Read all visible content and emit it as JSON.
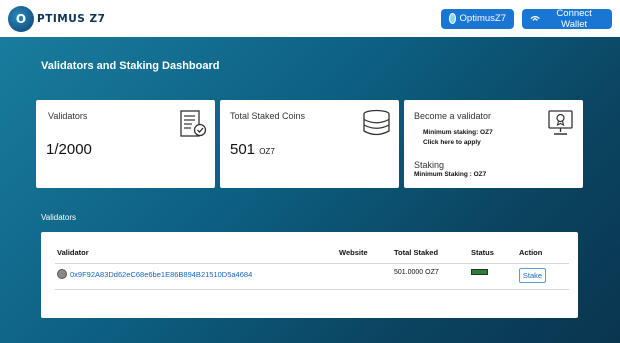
{
  "header": {
    "logo_letter": "O",
    "logo_text": "PTIMUS Z7",
    "network_button": "OptimusZ7",
    "wallet_button": "Connect Wallet"
  },
  "page": {
    "title": "Validators and Staking Dashboard"
  },
  "cards": {
    "validators": {
      "label": "Validators",
      "value": "1/2000"
    },
    "staked": {
      "label": "Total Staked Coins",
      "value": "501",
      "unit": "OZ7"
    },
    "become": {
      "label": "Become a validator",
      "min_staking": "Minimum staking: OZ7",
      "apply_link": "Click here to apply",
      "staking_label": "Staking",
      "staking_min": "Minimum Staking : OZ7"
    }
  },
  "validators_section": {
    "label": "Validators",
    "columns": [
      "Validator",
      "Website",
      "Total Staked",
      "Status",
      "Action"
    ],
    "rows": [
      {
        "address": "0x9F92A83Dd62eC68e6be1E86B894B21510D5a4684",
        "website": "",
        "total_staked": "501.0000 OZ7",
        "action": "Stake"
      }
    ]
  },
  "colors": {
    "accent": "#1976d2",
    "status_active": "#2e7d32",
    "link": "#1565c0"
  },
  "icons": {
    "validators": "certificate-icon",
    "staked": "coin-stack-icon",
    "become": "monitor-badge-icon"
  }
}
